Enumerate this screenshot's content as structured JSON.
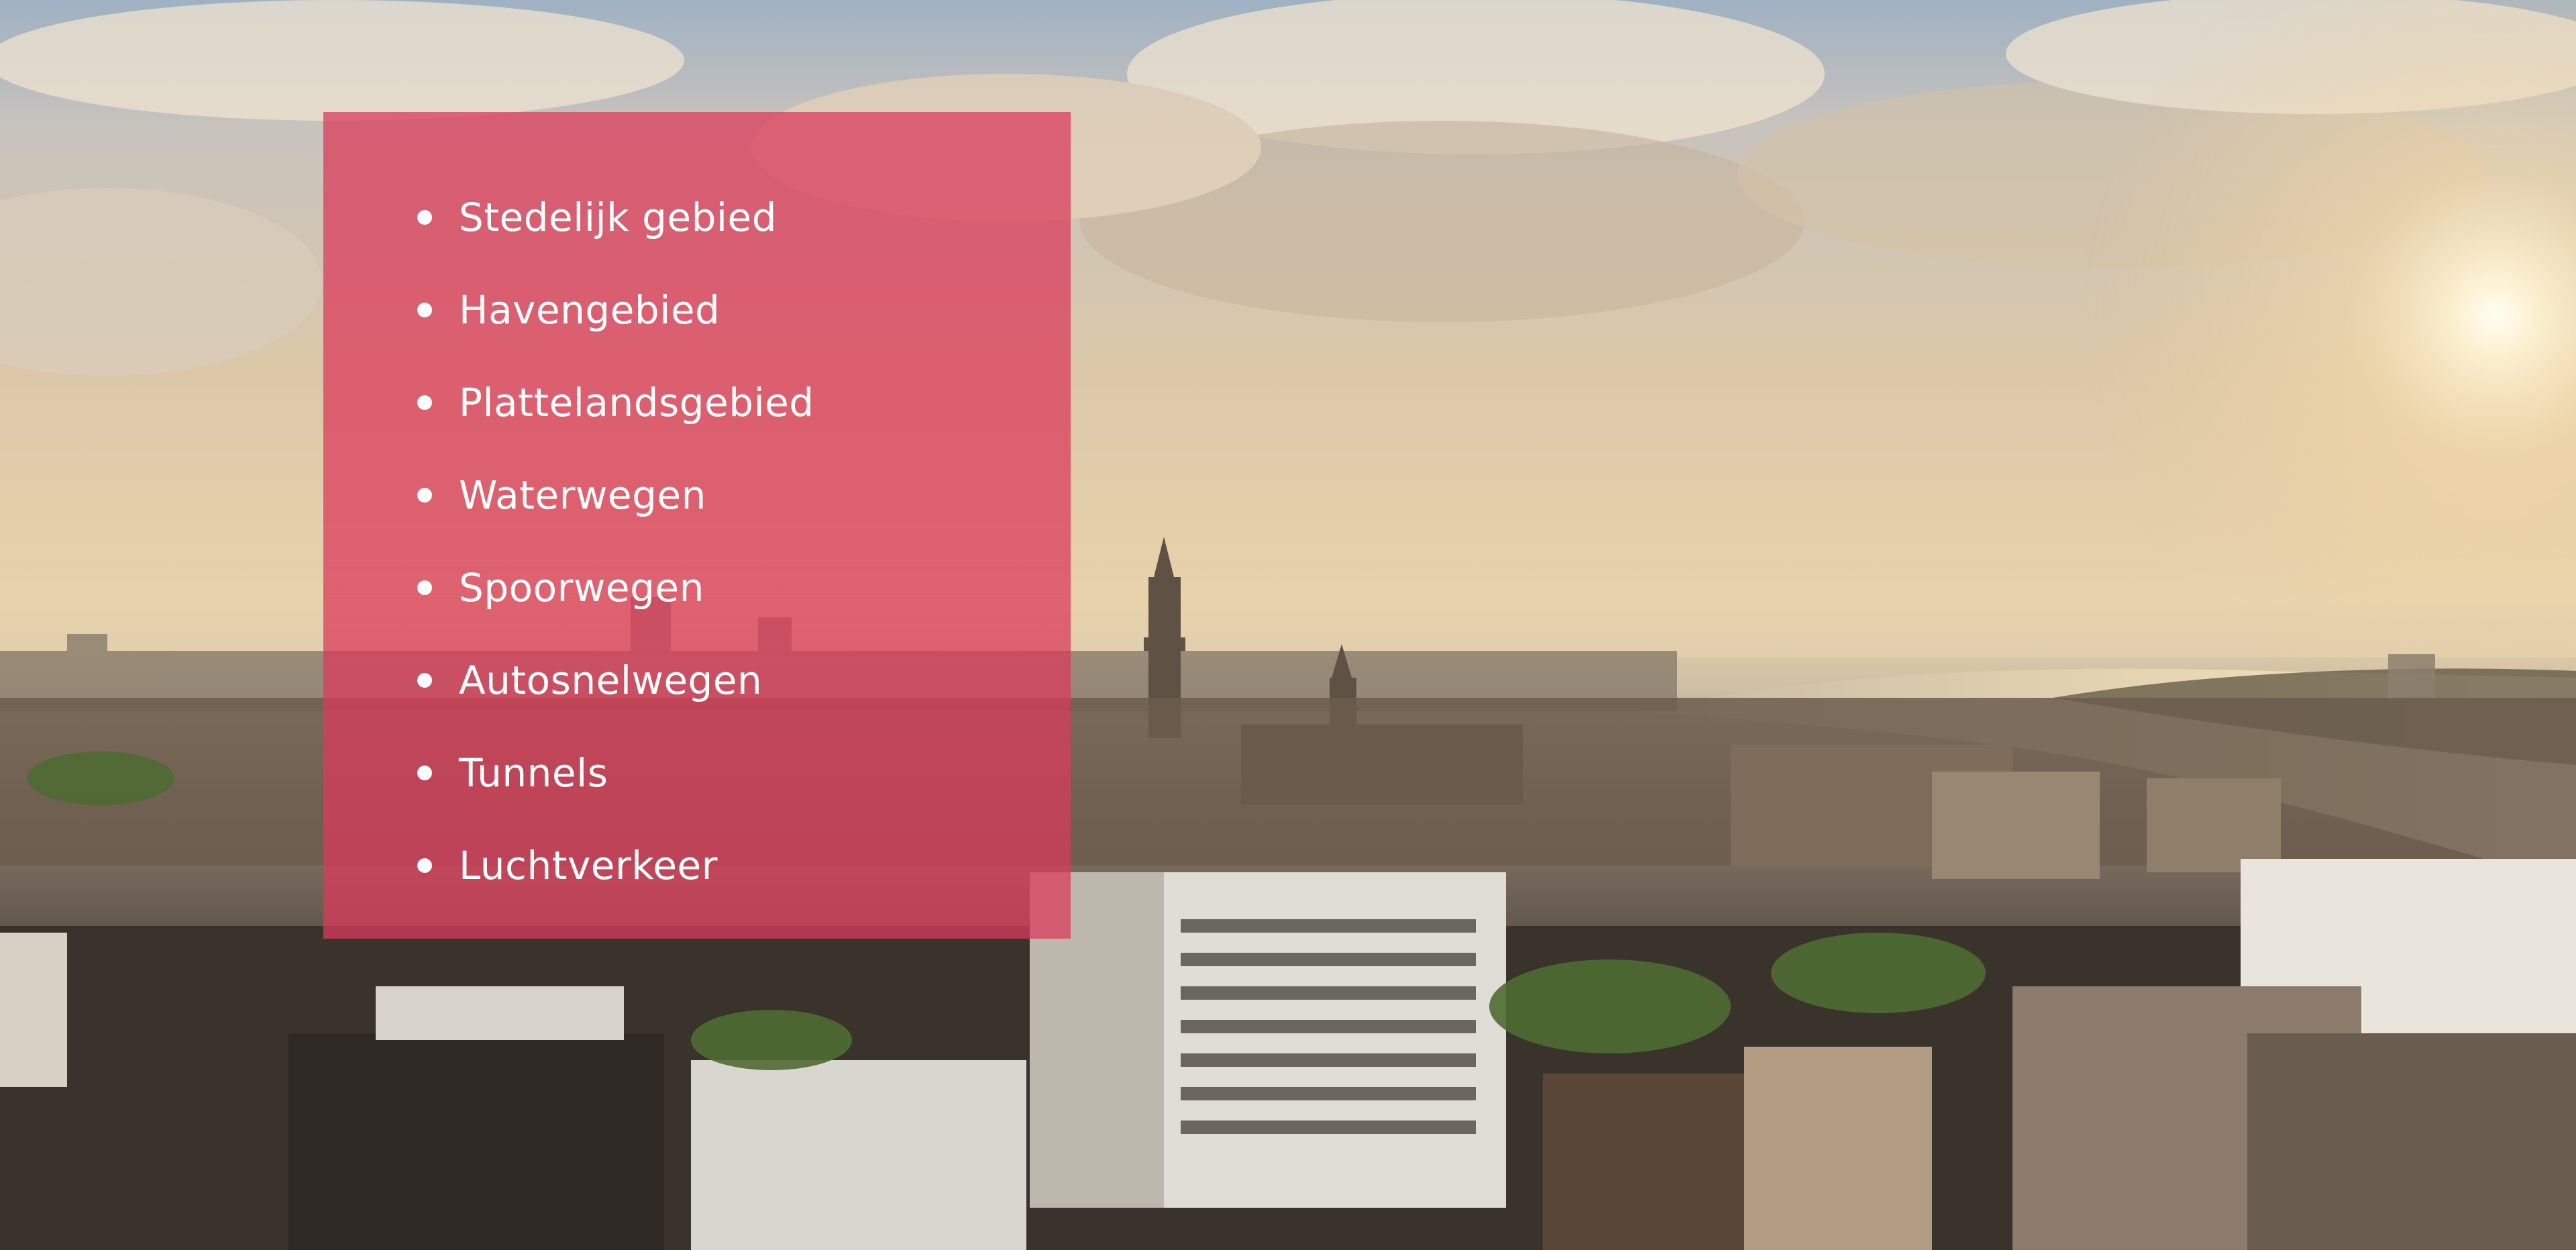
{
  "slide": {
    "list_items": [
      "Stedelijk gebied",
      "Havengebied",
      "Plattelandsgebied",
      "Waterwegen",
      "Spoorwegen",
      "Autosnelwegen",
      "Tunnels",
      "Luchtverkeer"
    ]
  },
  "colors": {
    "panel": "#db3a5a",
    "text": "#ffffff"
  }
}
